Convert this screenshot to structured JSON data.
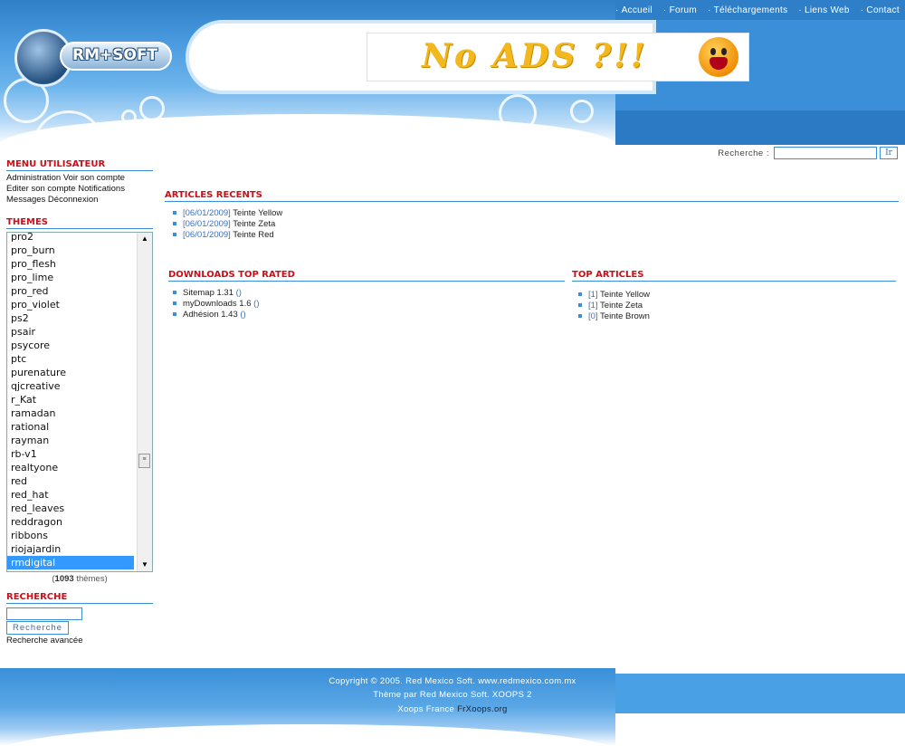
{
  "topnav": [
    "Accueil",
    "Forum",
    "Téléchargements",
    "Liens Web",
    "Contact"
  ],
  "logo_text": "RM+SOFT",
  "ad_banner": "No ADS ?!!",
  "top_search": {
    "label": "Recherche :",
    "button": "Ir",
    "value": ""
  },
  "user_menu": {
    "title": "MENU UTILISATEUR",
    "line1": "Administration Voir son compte",
    "line2": "Editer son compte Notifications",
    "line3": "Messages Déconnexion"
  },
  "themes": {
    "title": "THEMES",
    "options": [
      "pro2",
      "pro_burn",
      "pro_flesh",
      "pro_lime",
      "pro_red",
      "pro_violet",
      "ps2",
      "psair",
      "psycore",
      "ptc",
      "purenature",
      "qjcreative",
      "r_Kat",
      "ramadan",
      "rational",
      "rayman",
      "rb-v1",
      "realtyone",
      "red",
      "red_hat",
      "red_leaves",
      "reddragon",
      "ribbons",
      "riojajardin",
      "rmdigital"
    ],
    "selected": "rmdigital",
    "count": "1093",
    "count_suffix": "thèmes"
  },
  "side_search": {
    "title": "RECHERCHE",
    "button": "Recherche",
    "advanced": "Recherche avancée",
    "value": ""
  },
  "recent_articles": {
    "title": "ARTICLES RECENTS",
    "items": [
      {
        "date": "[06/01/2009]",
        "title": "Teinte Yellow"
      },
      {
        "date": "[06/01/2009]",
        "title": "Teinte Zeta"
      },
      {
        "date": "[06/01/2009]",
        "title": "Teinte Red"
      }
    ]
  },
  "downloads_top": {
    "title": "DOWNLOADS TOP RATED",
    "items": [
      {
        "name": "Sitemap 1.31",
        "suffix": "()"
      },
      {
        "name": "myDownloads 1.6",
        "suffix": "()"
      },
      {
        "name": "Adhésion 1.43",
        "suffix": "()"
      }
    ]
  },
  "top_articles": {
    "title": "TOP ARTICLES",
    "items": [
      {
        "rank": "[1]",
        "title": "Teinte Yellow"
      },
      {
        "rank": "[1]",
        "title": "Teinte Zeta"
      },
      {
        "rank": "[0]",
        "title": "Teinte Brown"
      }
    ]
  },
  "footer": {
    "line1": "Copyright © 2005. Red Mexico Soft. www.redmexico.com.mx",
    "line2": "Thème par Red Mexico Soft. XOOPS 2",
    "line3_a": "Xoops France",
    "line3_b": "FrXoops.org"
  },
  "colors": {
    "accent_blue": "#3a8fd8",
    "title_red": "#c8101a",
    "selected_option": "#3399ff"
  }
}
